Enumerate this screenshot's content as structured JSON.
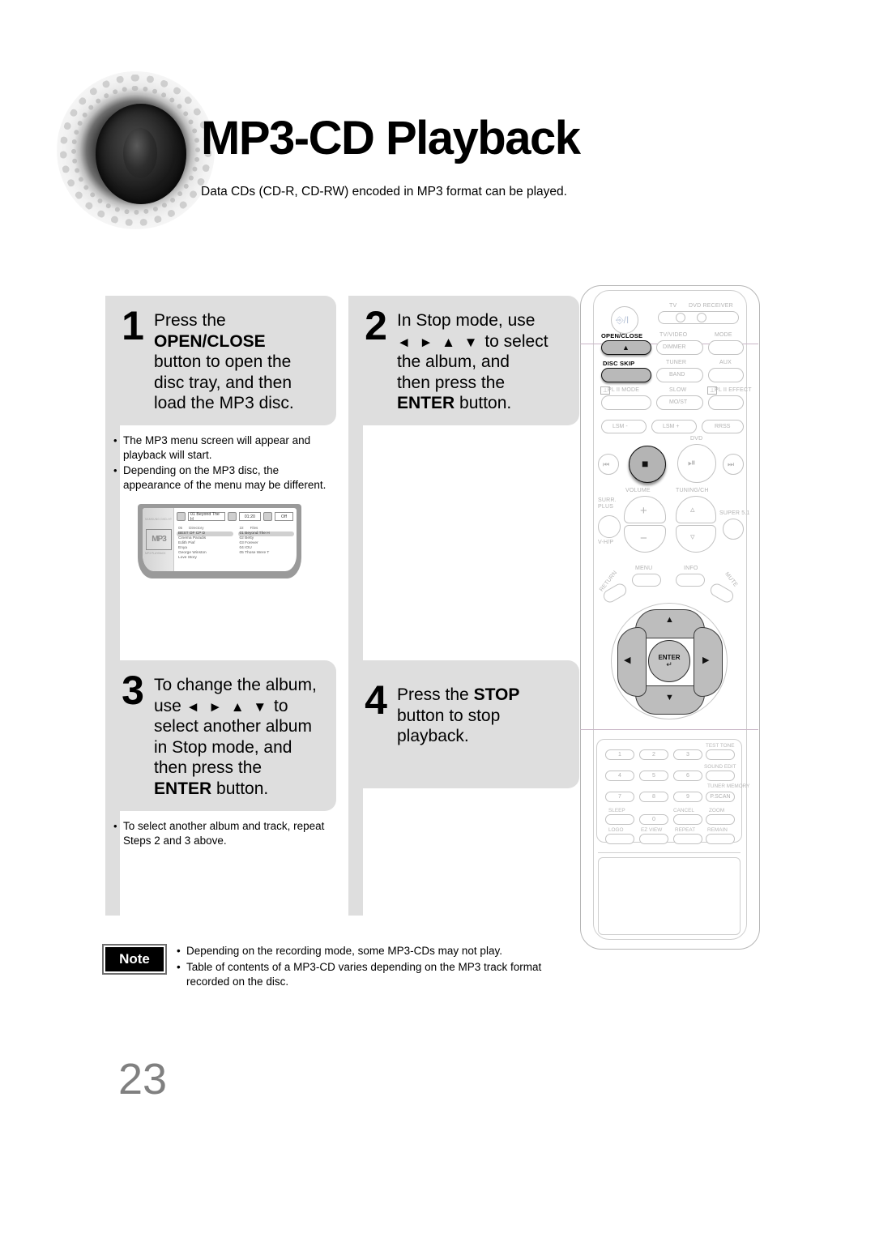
{
  "page": {
    "title": "MP3-CD Playback",
    "subtitle": "Data CDs (CD-R, CD-RW) encoded in MP3 format can be played.",
    "number": "23"
  },
  "steps": [
    {
      "number": "1",
      "line1": "Press the",
      "bold1": "OPEN/CLOSE",
      "line2": "button to open the",
      "line3": "disc tray, and then",
      "line4": "load the MP3 disc.",
      "bullets": [
        "The MP3 menu screen will appear and playback will start.",
        "Depending on the MP3 disc, the appearance of the menu may be different."
      ]
    },
    {
      "number": "2",
      "line1": "In Stop mode, use",
      "arrows": "◄ ► ▲ ▼",
      "line2": "to select",
      "line3": "the album, and",
      "line4": "then press the",
      "bold1": "ENTER",
      "line5": "button.",
      "bullets": []
    },
    {
      "number": "3",
      "line1": "To change the album,",
      "line2": "use",
      "arrows": "◄ ► ▲ ▼",
      "line3": "to",
      "line4": "select another album",
      "line5": "in Stop mode, and",
      "line6": "then press the",
      "bold1": "ENTER",
      "line7": "button.",
      "bullets": [
        "To select another album and track, repeat Steps 2 and 3 above."
      ]
    },
    {
      "number": "4",
      "line1": "Press the",
      "bold1": "STOP",
      "line2": "button to stop",
      "line3": "playback.",
      "bullets": []
    }
  ],
  "tv_screen": {
    "brand": "SAMSUNG DVD-HT",
    "logo": "MP3",
    "logo_sub": "DIGITAL",
    "footer": "MP3 PLAYBACK",
    "status": {
      "track": "01 Beyond The H",
      "time": "01:20",
      "repeat": "Off"
    },
    "left_column": {
      "count": "05",
      "header": "Directory",
      "items": [
        "BEST OF CP D",
        "Cinema Paradis",
        "Edith Piaf",
        "Enya",
        "George Winston",
        "Love Story"
      ],
      "selected_index": 0
    },
    "right_column": {
      "count": "22",
      "header": "Files",
      "items": [
        "01 Beyond The H",
        "02 Betty",
        "03 Forever",
        "04 IOU",
        "05 Those Were T"
      ],
      "selected_index": 0
    }
  },
  "note": {
    "badge": "Note",
    "items": [
      "Depending on the recording mode, some MP3-CDs may not play.",
      "Table of contents of a MP3-CD varies depending on the MP3 track format recorded on the disc."
    ]
  },
  "remote": {
    "power": "⏻/I",
    "mode_switch": {
      "left": "TV",
      "right": "DVD RECEIVER"
    },
    "buttons": {
      "open_close": "OPEN/CLOSE",
      "tv_video": "TV/VIDEO",
      "dimmer": "DIMMER",
      "mode": "MODE",
      "disc_skip": "DISC SKIP",
      "tuner": "TUNER",
      "band": "BAND",
      "aux": "AUX",
      "pl2_mode": "PL II MODE",
      "slow": "SLOW",
      "most": "MO/ST",
      "pl2_effect": "PL II EFFECT",
      "lsm_minus": "LSM -",
      "lsm_plus": "LSM +",
      "rrss": "RRSS",
      "dvd": "DVD",
      "volume": "VOLUME",
      "tuning_ch": "TUNING/CH",
      "surr_plus": "SURR. PLUS",
      "vhp": "V-H/P",
      "super51": "SUPER 5.1",
      "menu": "MENU",
      "info": "INFO",
      "return": "RETURN",
      "mute": "MUTE",
      "enter": "ENTER",
      "test_tone": "TEST TONE",
      "sound_edit": "SOUND EDIT",
      "tuner_memory": "TUNER MEMORY",
      "pscan": "P.SCAN",
      "sleep": "SLEEP",
      "cancel": "CANCEL",
      "zoom": "ZOOM",
      "logo": "LOGO",
      "ez_view": "EZ VIEW",
      "repeat": "REPEAT",
      "remain": "REMAIN"
    },
    "keypad": [
      "1",
      "2",
      "3",
      "4",
      "5",
      "6",
      "7",
      "8",
      "9",
      "0"
    ]
  }
}
